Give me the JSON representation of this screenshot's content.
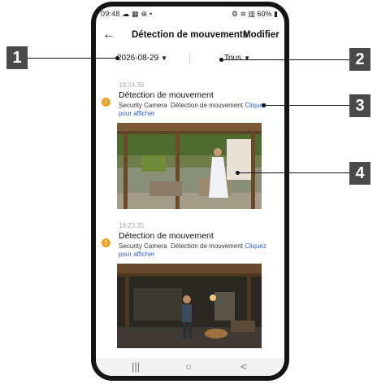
{
  "status_bar": {
    "time": "09:48",
    "left_icons": "☁ ▦ ⊕ •",
    "right": "⚙ ≋ ▥ 60% ▮"
  },
  "header": {
    "back_icon": "arrow-left-icon",
    "back_glyph": "←",
    "title": "Détection de mouvements",
    "modify_label": "Modifier"
  },
  "filters": {
    "date": "2026-08-29",
    "type": "Tous",
    "caret": "▼"
  },
  "events": [
    {
      "time": "18:24:39",
      "title": "Détection de mouvement",
      "camera": "Security Camera",
      "description": "Détection de mouvement",
      "link_text": "Cliquez pour afficher"
    },
    {
      "time": "18:23:35",
      "title": "Détection de mouvement",
      "camera": "Security Camera",
      "description": "Détection de mouvement",
      "link_text": "Cliquez pour afficher"
    }
  ],
  "alert_glyph": "!",
  "navbar": {
    "recents": "|||",
    "home": "○",
    "back": "<"
  },
  "callouts": [
    "1",
    "2",
    "3",
    "4"
  ],
  "colors": {
    "alert": "#f0a028",
    "link": "#2b5fd1",
    "callout_bg": "#4a4a4a"
  }
}
